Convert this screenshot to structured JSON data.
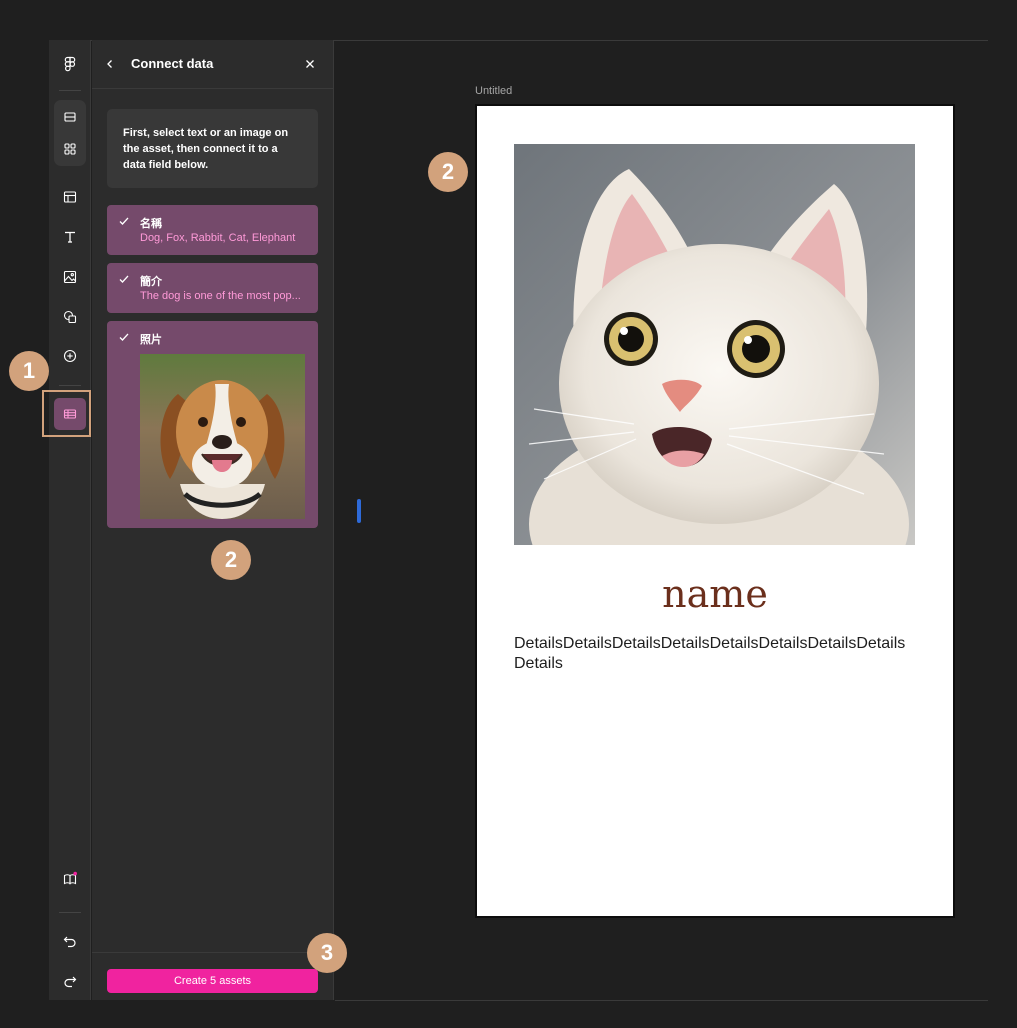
{
  "panel": {
    "title": "Connect data",
    "instructions": "First, select text or an image on the asset, then connect it to a data field below.",
    "fields": [
      {
        "name": "名稱",
        "value": "Dog, Fox, Rabbit, Cat, Elephant"
      },
      {
        "name": "簡介",
        "value": "The dog is one of the most pop..."
      },
      {
        "name": "照片",
        "value": ""
      }
    ],
    "create_label": "Create 5 assets"
  },
  "canvas": {
    "frame_label": "Untitled",
    "asset_name": "name",
    "asset_details": "DetailsDetailsDetailsDetailsDetailsDetailsDetailsDetailsDetails"
  },
  "badges": {
    "one": "1",
    "two": "2",
    "three": "3"
  },
  "icons": {
    "rail": [
      "figma-logo-icon",
      "frame-tool-icon",
      "components-icon",
      "layout-icon",
      "text-tool-icon",
      "image-tool-icon",
      "shapes-icon",
      "add-plugin-icon",
      "table-data-icon",
      "library-book-icon",
      "undo-icon",
      "redo-icon"
    ],
    "header": [
      "back-chevron-icon",
      "close-icon"
    ]
  },
  "colors": {
    "accent": "#f0239f",
    "field_card": "#754a6b",
    "field_value": "#ff9ad8",
    "badge": "#d2a27c",
    "asset_name": "#6b2f1c"
  }
}
